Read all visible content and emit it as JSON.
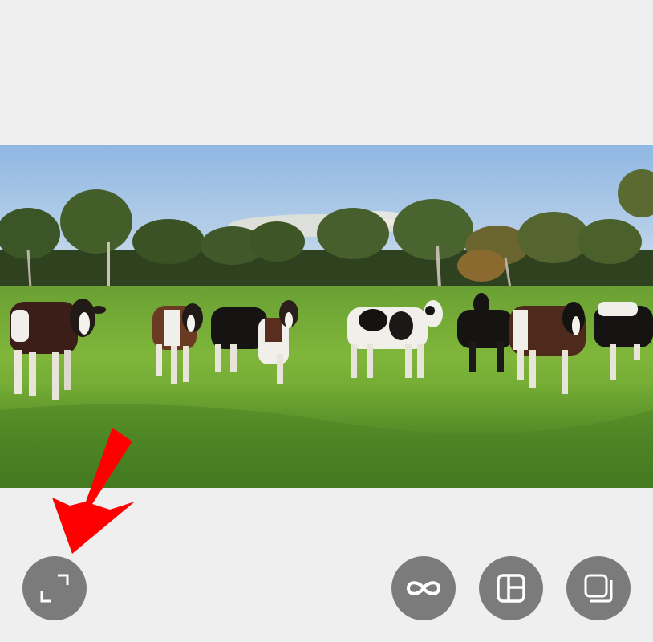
{
  "photo": {
    "subject": "cows-in-field"
  },
  "annotation": {
    "arrow_color": "#ff0000",
    "arrow_target": "expand-button"
  },
  "controls": {
    "button_color": "#7b7b7b",
    "icon_color": "#ffffff",
    "buttons": [
      {
        "icon": "expand-icon"
      },
      {
        "icon": "infinity-icon"
      },
      {
        "icon": "layout-icon"
      },
      {
        "icon": "stack-icon"
      }
    ]
  }
}
